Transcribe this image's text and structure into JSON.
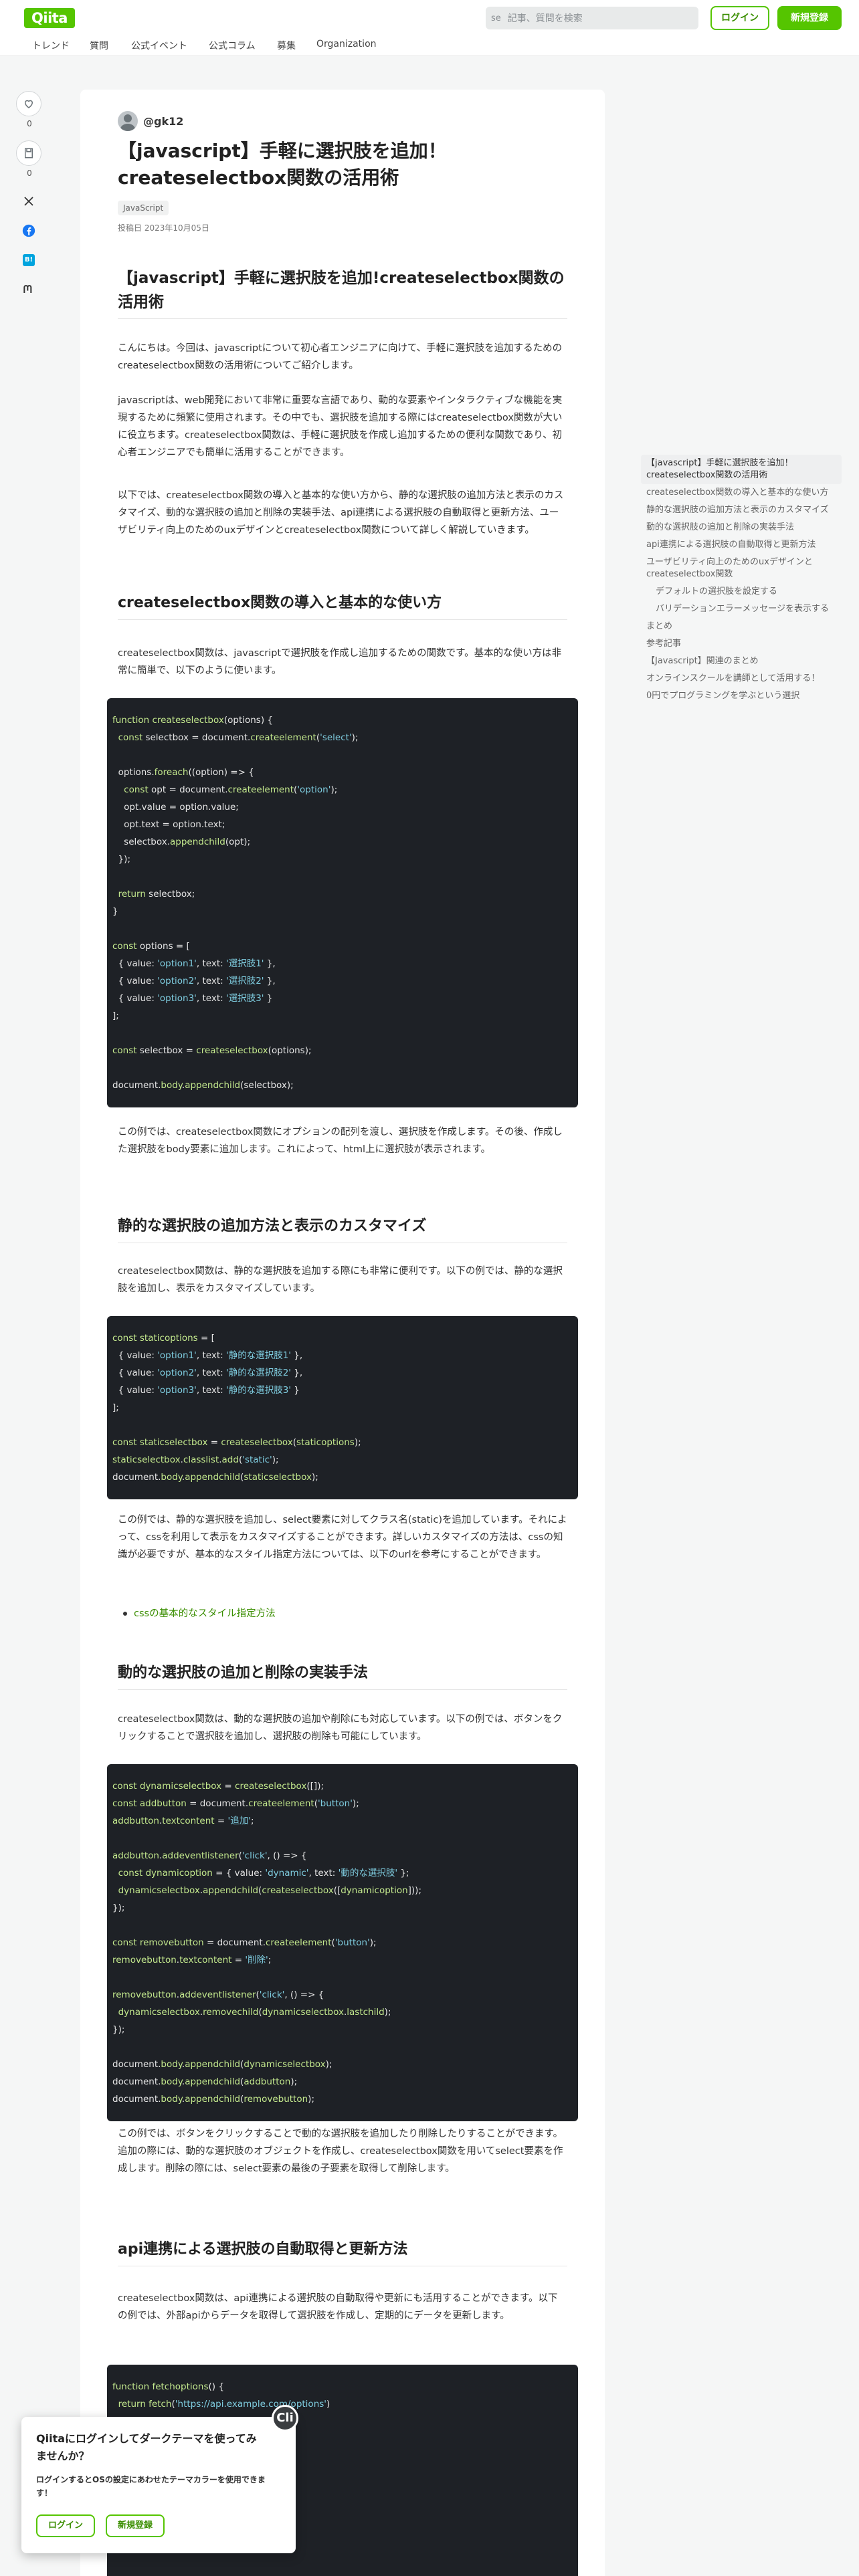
{
  "header": {
    "logo": "Qiita",
    "search_shortcut": "se",
    "search_placeholder": "記事、質問を検索",
    "login": "ログイン",
    "signup": "新規登録"
  },
  "nav": [
    "トレンド",
    "質問",
    "公式イベント",
    "公式コラム",
    "募集",
    "Organization"
  ],
  "rail": {
    "like_count": "0",
    "stock_count": "0",
    "hatena_label": "B!"
  },
  "article": {
    "author": "@gk12",
    "title": "【javascript】手軽に選択肢を追加！createselectbox関数の活用術",
    "tag": "JavaScript",
    "posted": "投稿日 2023年10月05日",
    "h1": "【javascript】手軽に選択肢を追加!createselectbox関数の活用術",
    "intro": [
      "こんにちは。今回は、javascriptについて初心者エンジニアに向けて、手軽に選択肢を追加するためのcreateselectbox関数の活用術についてご紹介します。",
      "javascriptは、web開発において非常に重要な言語であり、動的な要素やインタラクティブな機能を実現するために頻繁に使用されます。その中でも、選択肢を追加する際にはcreateselectbox関数が大いに役立ちます。createselectbox関数は、手軽に選択肢を作成し追加するための便利な関数であり、初心者エンジニアでも簡単に活用することができます。",
      "以下では、createselectbox関数の導入と基本的な使い方から、静的な選択肢の追加方法と表示のカスタマイズ、動的な選択肢の追加と削除の実装手法、api連携による選択肢の自動取得と更新方法、ユーザビリティ向上のためのuxデザインとcreateselectbox関数について詳しく解説していきます。"
    ],
    "s1": {
      "heading": "createselectbox関数の導入と基本的な使い方",
      "p": "createselectbox関数は、javascriptで選択肢を作成し追加するための関数です。基本的な使い方は非常に簡単で、以下のように使います。",
      "code": [
        "function createselectbox(options) {",
        "  const selectbox = document.createelement('select');",
        "",
        "  options.foreach((option) => {",
        "    const opt = document.createelement('option');",
        "    opt.value = option.value;",
        "    opt.text = option.text;",
        "    selectbox.appendchild(opt);",
        "  });",
        "",
        "  return selectbox;",
        "}",
        "",
        "const options = [",
        "  { value: 'option1', text: '選択肢1' },",
        "  { value: 'option2', text: '選択肢2' },",
        "  { value: 'option3', text: '選択肢3' }",
        "];",
        "",
        "const selectbox = createselectbox(options);",
        "",
        "document.body.appendchild(selectbox);"
      ],
      "after": "この例では、createselectbox関数にオプションの配列を渡し、選択肢を作成します。その後、作成した選択肢をbody要素に追加します。これによって、html上に選択肢が表示されます。"
    },
    "s2": {
      "heading": "静的な選択肢の追加方法と表示のカスタマイズ",
      "p": "createselectbox関数は、静的な選択肢を追加する際にも非常に便利です。以下の例では、静的な選択肢を追加し、表示をカスタマイズしています。",
      "code": [
        "const staticoptions = [",
        "  { value: 'option1', text: '静的な選択肢1' },",
        "  { value: 'option2', text: '静的な選択肢2' },",
        "  { value: 'option3', text: '静的な選択肢3' }",
        "];",
        "",
        "const staticselectbox = createselectbox(staticoptions);",
        "staticselectbox.classlist.add('static');",
        "document.body.appendchild(staticselectbox);"
      ],
      "after": "この例では、静的な選択肢を追加し、select要素に対してクラス名(static)を追加しています。それによって、cssを利用して表示をカスタマイズすることができます。詳しいカスタマイズの方法は、cssの知識が必要ですが、基本的なスタイル指定方法については、以下のurlを参考にすることができます。",
      "link": "cssの基本的なスタイル指定方法"
    },
    "s3": {
      "heading": "動的な選択肢の追加と削除の実装手法",
      "p": "createselectbox関数は、動的な選択肢の追加や削除にも対応しています。以下の例では、ボタンをクリックすることで選択肢を追加し、選択肢の削除も可能にしています。",
      "code": [
        "const dynamicselectbox = createselectbox([]);",
        "const addbutton = document.createelement('button');",
        "addbutton.textcontent = '追加';",
        "",
        "addbutton.addeventlistener('click', () => {",
        "  const dynamicoption = { value: 'dynamic', text: '動的な選択肢' };",
        "  dynamicselectbox.appendchild(createselectbox([dynamicoption]));",
        "});",
        "",
        "const removebutton = document.createelement('button');",
        "removebutton.textcontent = '削除';",
        "",
        "removebutton.addeventlistener('click', () => {",
        "  dynamicselectbox.removechild(dynamicselectbox.lastchild);",
        "});",
        "",
        "document.body.appendchild(dynamicselectbox);",
        "document.body.appendchild(addbutton);",
        "document.body.appendchild(removebutton);"
      ],
      "after": "この例では、ボタンをクリックすることで動的な選択肢を追加したり削除したりすることができます。追加の際には、動的な選択肢のオブジェクトを作成し、createselectbox関数を用いてselect要素を作成します。削除の際には、select要素の最後の子要素を取得して削除します。"
    },
    "s4": {
      "heading": "api連携による選択肢の自動取得と更新方法",
      "p": "createselectbox関数は、api連携による選択肢の自動取得や更新にも活用することができます。以下の例では、外部apiからデータを取得して選択肢を作成し、定期的にデータを更新します。",
      "code": [
        "function fetchoptions() {",
        "  return fetch('https://api.example.com/options')",
        "",
        "",
        "",
        "",
        "                                    ector('.api');",
        "",
        ""
      ]
    }
  },
  "toc": [
    {
      "label": "【javascript】手軽に選択肢を追加！createselectbox関数の活用術",
      "active": true,
      "sub": false
    },
    {
      "label": "createselectbox関数の導入と基本的な使い方",
      "active": false,
      "sub": false
    },
    {
      "label": "静的な選択肢の追加方法と表示のカスタマイズ",
      "active": false,
      "sub": false
    },
    {
      "label": "動的な選択肢の追加と削除の実装手法",
      "active": false,
      "sub": false
    },
    {
      "label": "api連携による選択肢の自動取得と更新方法",
      "active": false,
      "sub": false
    },
    {
      "label": "ユーザビリティ向上のためのuxデザインとcreateselectbox関数",
      "active": false,
      "sub": false
    },
    {
      "label": "デフォルトの選択肢を設定する",
      "active": false,
      "sub": true
    },
    {
      "label": "バリデーションエラーメッセージを表示する",
      "active": false,
      "sub": true
    },
    {
      "label": "まとめ",
      "active": false,
      "sub": false
    },
    {
      "label": "参考記事",
      "active": false,
      "sub": false
    },
    {
      "label": "【Javascript】関連のまとめ",
      "active": false,
      "sub": false
    },
    {
      "label": "オンラインスクールを講師として活用する！",
      "active": false,
      "sub": false
    },
    {
      "label": "0円でプログラミングを学ぶという選択",
      "active": false,
      "sub": false
    }
  ],
  "popup": {
    "title": "Qiitaにログインしてダークテーマを使ってみませんか？",
    "text": "ログインするとOSの設定にあわせたテーマカラーを使用できます！",
    "login": "ログイン",
    "signup": "新規登録",
    "close": "Cli"
  },
  "colors": {
    "brand": "#55c500",
    "code_bg": "#1e2126",
    "code_keyword": "#c3e88d",
    "code_string": "#7fcde0"
  }
}
